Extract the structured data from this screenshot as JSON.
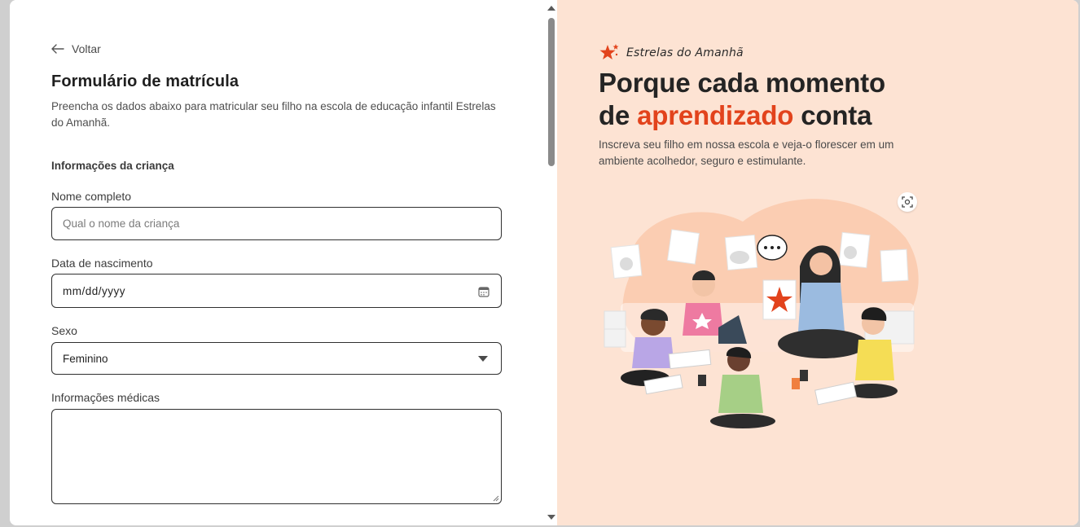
{
  "form": {
    "back_label": "Voltar",
    "title": "Formulário de matrícula",
    "description": "Preencha os dados abaixo para matricular seu filho na escola de educação infantil Estrelas do Amanhã.",
    "section_title": "Informações da criança",
    "fields": {
      "full_name": {
        "label": "Nome completo",
        "placeholder": "Qual o nome da criança",
        "value": ""
      },
      "birth_date": {
        "label": "Data de nascimento",
        "placeholder": "mm/dd/yyyy"
      },
      "sex": {
        "label": "Sexo",
        "selected": "Feminino"
      },
      "medical": {
        "label": "Informações médicas",
        "value": ""
      }
    }
  },
  "hero": {
    "brand_name": "Estrelas do Amanhã",
    "headline_part1": "Porque cada momento",
    "headline_part2_prefix": "de ",
    "headline_accent": "aprendizado",
    "headline_part2_suffix": " conta",
    "subtext": "Inscreva seu filho em nossa escola e veja-o florescer em um ambiente acolhedor, seguro e estimulante."
  },
  "colors": {
    "accent": "#e2431c",
    "hero_background": "#fde3d3",
    "text_dark": "#242424"
  },
  "icons": {
    "back": "arrow-left-icon",
    "calendar": "calendar-icon",
    "brand": "star-logo-icon",
    "scan": "scan-icon"
  }
}
